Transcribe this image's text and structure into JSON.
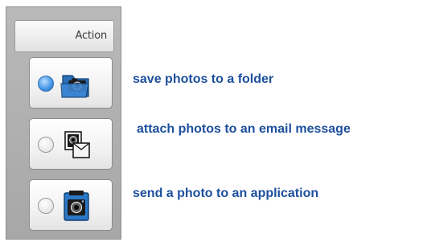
{
  "panel": {
    "header_label": "Action"
  },
  "actions": [
    {
      "selected": true,
      "icon": "folder-camera-icon",
      "caption": "save photos to a folder"
    },
    {
      "selected": false,
      "icon": "email-photo-icon",
      "caption": "attach photos to an email message"
    },
    {
      "selected": false,
      "icon": "camera-app-icon",
      "caption": "send a photo to an application"
    }
  ],
  "colors": {
    "caption_text": "#1d4f9c",
    "selected_radio": "#4a9be8"
  }
}
